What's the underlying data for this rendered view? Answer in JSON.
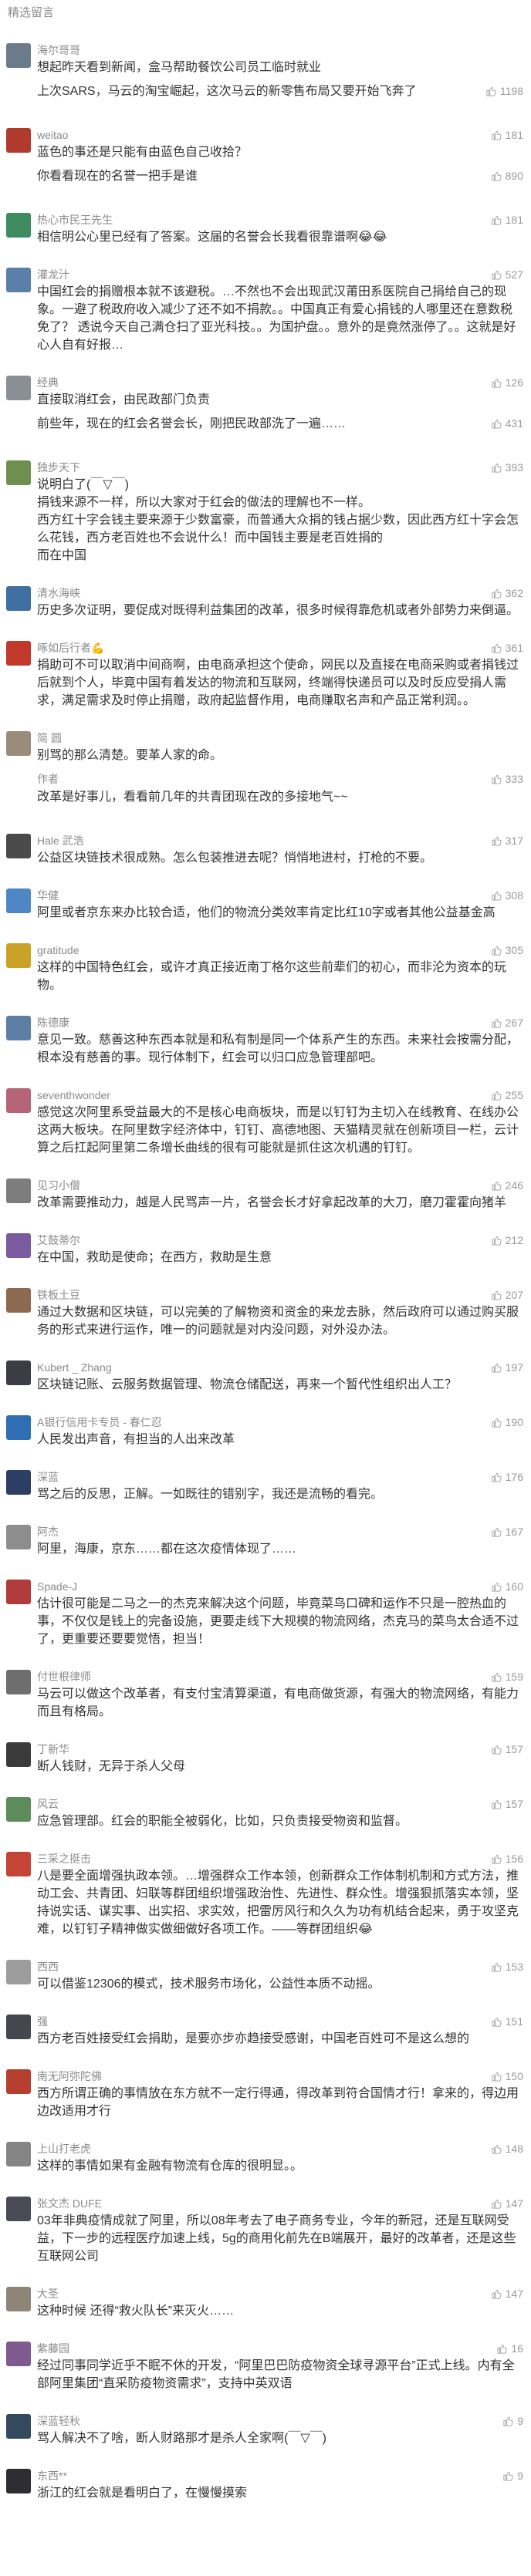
{
  "section_title": "精选留言",
  "comments": [
    {
      "name": "海尔哥哥",
      "avatar_color": "#6b7b8c",
      "likes": null,
      "text": "想起昨天看到新闻，盒马帮助餐饮公司员工临时就业",
      "reply": {
        "label": "",
        "text": "上次SARS，马云的淘宝崛起，这次马云的新零售布局又要开始飞奔了",
        "likes": 1198
      }
    },
    {
      "name": "weitao",
      "avatar_color": "#b03a2e",
      "likes": 181,
      "text": "蓝色的事还是只能有由蓝色自己收拾？",
      "reply": {
        "label": "",
        "text": "你看看现在的名誉一把手是谁",
        "likes": 890
      }
    },
    {
      "name": "热心市民王先生",
      "avatar_color": "#3d8b5f",
      "likes": 181,
      "text": "相信明公心里已经有了答案。这届的名誉会长我看很靠谱啊😂😂",
      "reply": null
    },
    {
      "name": "灌龙汁",
      "avatar_color": "#5a7fa8",
      "likes": 527,
      "text": "中国红会的捐赠根本就不该避税。…不然也不会出现武汉莆田系医院自己捐给自己的现象。一避了税政府收入减少了还不如不捐款。。中国真正有爱心捐钱的人哪里还在意数税免了？ 透说今天自己满仓扫了亚光科技。。为国护盘。。意外的是竟然涨停了。。这就是好心人自有好报…",
      "reply": null
    },
    {
      "name": "经典",
      "avatar_color": "#8a8f96",
      "likes": 126,
      "text": "直接取消红会，由民政部门负责",
      "reply": {
        "label": "",
        "text": "前些年，现在的红会名誉会长，刚把民政部洗了一遍……",
        "likes": 431
      }
    },
    {
      "name": "独步天下",
      "avatar_color": "#6f8f4e",
      "likes": 393,
      "text": "说明白了(￣▽￣)\n捐钱来源不一样，所以大家对于红会的做法的理解也不一样。\n西方红十字会钱主要来源于少数富豪，而普通大众捐的钱占据少数，因此西方红十字会怎么花钱，西方老百姓也不会说什么！而中国钱主要是老百姓捐的\n而在中国",
      "reply": null
    },
    {
      "name": "清水海峡",
      "avatar_color": "#3f6fa0",
      "likes": 362,
      "text": "历史多次证明，要促成对既得利益集团的改革，很多时候得靠危机或者外部势力来倒逼。",
      "reply": null
    },
    {
      "name": "啄如后行者💪",
      "avatar_color": "#c0392b",
      "likes": 361,
      "text": "捐助可不可以取消中间商啊，由电商承担这个使命，网民以及直接在电商采购或者捐钱过后就到个人，毕竟中国有着发达的物流和互联网，终端得快递员可以及时反应受捐人需求，满足需求及时停止捐赠，政府起监督作用，电商赚取名声和产品正常利润。。",
      "reply": null
    },
    {
      "name": "简 圆",
      "avatar_color": "#9a8c7a",
      "likes": null,
      "text": "别骂的那么清楚。要革人家的命。",
      "reply": {
        "label": "作者",
        "text": "改革是好事儿，看看前几年的共青团现在改的多接地气~~",
        "likes": 333
      }
    },
    {
      "name": "Hale 武浩",
      "avatar_color": "#4a4a4a",
      "likes": 317,
      "text": "公益区块链技术很成熟。怎么包装推进去呢？悄悄地进村，打枪的不要。",
      "reply": null
    },
    {
      "name": "华健",
      "avatar_color": "#4f86c6",
      "likes": 308,
      "text": "阿里或者京东来办比较合适，他们的物流分类效率肯定比红10字或者其他公益基金高",
      "reply": null
    },
    {
      "name": "gratitude",
      "avatar_color": "#c9a227",
      "likes": 305,
      "text": "这样的中国特色红会，或许才真正接近南丁格尔这些前辈们的初心，而非沦为资本的玩物。",
      "reply": null
    },
    {
      "name": "陈德康",
      "avatar_color": "#5d7fa3",
      "likes": 267,
      "text": "意见一致。慈善这种东西本就是和私有制是同一个体系产生的东西。未来社会按需分配，根本没有慈善的事。现行体制下，红会可以归口应急管理部吧。",
      "reply": null
    },
    {
      "name": "seventhwonder",
      "avatar_color": "#b56576",
      "likes": 255,
      "text": "感觉这次阿里系受益最大的不是核心电商板块，而是以钉钉为主切入在线教育、在线办公这两大板块。在阿里数字经济体中，钉钉、高德地图、天猫精灵就在创新项目一栏，云计算之后扛起阿里第二条增长曲线的很有可能就是抓住这次机遇的钉钉。",
      "reply": null
    },
    {
      "name": "见习小僧",
      "avatar_color": "#7d7d7d",
      "likes": 246,
      "text": "改革需要推动力，越是人民骂声一片，名誉会长才好拿起改革的大刀，磨刀霍霍向猪羊",
      "reply": null
    },
    {
      "name": "艾鼓蒂尔",
      "avatar_color": "#7a5c9e",
      "likes": 212,
      "text": "在中国，救助是使命；在西方，救助是生意",
      "reply": null
    },
    {
      "name": "铁板土豆",
      "avatar_color": "#8c6a4f",
      "likes": 207,
      "text": "通过大数据和区块链，可以完美的了解物资和资金的来龙去脉，然后政府可以通过购买服务的形式来进行运作，唯一的问题就是对内没问题，对外没办法。",
      "reply": null
    },
    {
      "name": "Kubert _ Zhang",
      "avatar_color": "#3c3c46",
      "likes": 197,
      "text": "区块链记账、云服务数据管理、物流仓储配送，再来一个暂代性组织出人工？",
      "reply": null
    },
    {
      "name": "A银行信用卡专员 - 春仁忍",
      "avatar_color": "#2f6db5",
      "likes": 190,
      "text": "人民发出声音，有担当的人出来改革",
      "reply": null
    },
    {
      "name": "深蓝",
      "avatar_color": "#2c3e64",
      "likes": 176,
      "text": "骂之后的反思，正解。一如既往的错别字，我还是流畅的看完。",
      "reply": null
    },
    {
      "name": "阿杰",
      "avatar_color": "#8d8d8d",
      "likes": 167,
      "text": "阿里，海康，京东……都在这次疫情体现了……",
      "reply": null
    },
    {
      "name": "Spade-J",
      "avatar_color": "#b23b3b",
      "likes": 160,
      "text": "估计很可能是二马之一的杰克来解决这个问题，毕竟菜鸟口碑和运作不只是一腔热血的事，不仅仅是钱上的完备设施，更要走线下大规模的物流网络，杰克马的菜鸟太合适不过了，更重要还要要觉悟，担当！",
      "reply": null
    },
    {
      "name": "付世根律师",
      "avatar_color": "#6e6e6e",
      "likes": 159,
      "text": "马云可以做这个改革者，有支付宝清算渠道，有电商做货源，有强大的物流网络，有能力而且有格局。",
      "reply": null
    },
    {
      "name": "丁新华",
      "avatar_color": "#3b3b3b",
      "likes": 157,
      "text": "断人钱财，无异于杀人父母",
      "reply": null
    },
    {
      "name": "风云",
      "avatar_color": "#5b8c5a",
      "likes": 157,
      "text": "应急管理部。红会的职能全被弱化，比如，只负责接受物资和监督。",
      "reply": null
    },
    {
      "name": "三采之挺击",
      "avatar_color": "#c44536",
      "likes": 156,
      "text": "八是要全面增强执政本领。…增强群众工作本领，创新群众工作体制机制和方式方法，推动工会、共青团、妇联等群团组织增强政治性、先进性、群众性。增强狠抓落实本领，坚持说实话、谋实事、出实招、求实效，把雷厉风行和久久为功有机结合起来，勇于攻坚克难，以钉钉子精神做实做细做好各项工作。——等群团组织😂",
      "reply": null
    },
    {
      "name": "西西",
      "avatar_color": "#9c9c9c",
      "likes": 153,
      "text": "可以借鉴12306的模式，技术服务市场化，公益性本质不动摇。",
      "reply": null
    },
    {
      "name": "强",
      "avatar_color": "#44474f",
      "likes": 151,
      "text": "西方老百姓接受红会捐助，是要亦步亦趋接受感谢，中国老百姓可不是这么想的",
      "reply": null
    },
    {
      "name": "南无阿弥陀佛",
      "avatar_color": "#b5402f",
      "likes": 150,
      "text": "西方所谓正确的事情放在东方就不一定行得通，得改革到符合国情才行！拿来的，得边用边改适用才行",
      "reply": null
    },
    {
      "name": "上山打老虎",
      "avatar_color": "#858585",
      "likes": 148,
      "text": "这样的事情如果有金融有物流有仓库的很明显。。",
      "reply": null
    },
    {
      "name": "张文杰 DUFE",
      "avatar_color": "#4b4b55",
      "likes": 147,
      "text": "03年非典疫情成就了阿里，所以08年考去了电子商务专业，今年的新冠，还是互联网受益，下一步的远程医疗加速上线，5g的商用化前先在B端展开，最好的改革者，还是这些互联网公司",
      "reply": null
    },
    {
      "name": "大圣",
      "avatar_color": "#8f8478",
      "likes": 147,
      "text": "这种时候 还得“救火队长”来灭火……",
      "reply": null
    },
    {
      "name": "紫藤园",
      "avatar_color": "#7e5a8e",
      "likes": 16,
      "text": "经过同事同学近乎不眠不休的开发，“阿里巴巴防疫物资全球寻源平台”正式上线。内有全部阿里集团“直采防疫物资需求”，支持中英双语",
      "reply": null
    },
    {
      "name": "深蓝轻秋",
      "avatar_color": "#34495e",
      "likes": 9,
      "text": "骂人解决不了啥，断人财路那才是杀人全家啊(￣▽￣)",
      "reply": null
    },
    {
      "name": "东西**",
      "avatar_color": "#2d2d33",
      "likes": 9,
      "text": "浙江的红会就是看明白了，在慢慢摸索",
      "reply": null
    }
  ]
}
